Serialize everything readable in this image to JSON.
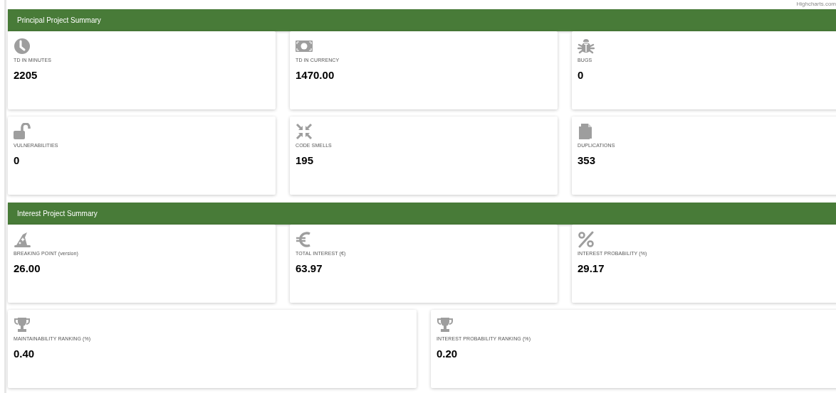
{
  "credit": "Highcharts.com",
  "sections": [
    {
      "title": "Principal Project Summary",
      "rows": [
        [
          {
            "label": "TD IN MINUTES",
            "value": "2205"
          },
          {
            "label": "TD IN CURRENCY",
            "value": "1470.00"
          },
          {
            "label": "BUGS",
            "value": "0"
          }
        ],
        [
          {
            "label": "VULNERABILITIES",
            "value": "0"
          },
          {
            "label": "CODE SMELLS",
            "value": "195"
          },
          {
            "label": "DUPLICATIONS",
            "value": "353"
          }
        ]
      ]
    },
    {
      "title": "Interest Project Summary",
      "rows": [
        [
          {
            "label": "BREAKING POINT (version)",
            "value": "26.00"
          },
          {
            "label": "TOTAL INTEREST (€)",
            "value": "63.97"
          },
          {
            "label": "INTEREST PROBABILITY (%)",
            "value": "29.17"
          }
        ],
        [
          {
            "label": "MAINTAINABILITY RANKING (%)",
            "value": "0.40"
          },
          {
            "label": "INTEREST PROBABILITY RANKING (%)",
            "value": "0.20"
          }
        ]
      ]
    }
  ]
}
